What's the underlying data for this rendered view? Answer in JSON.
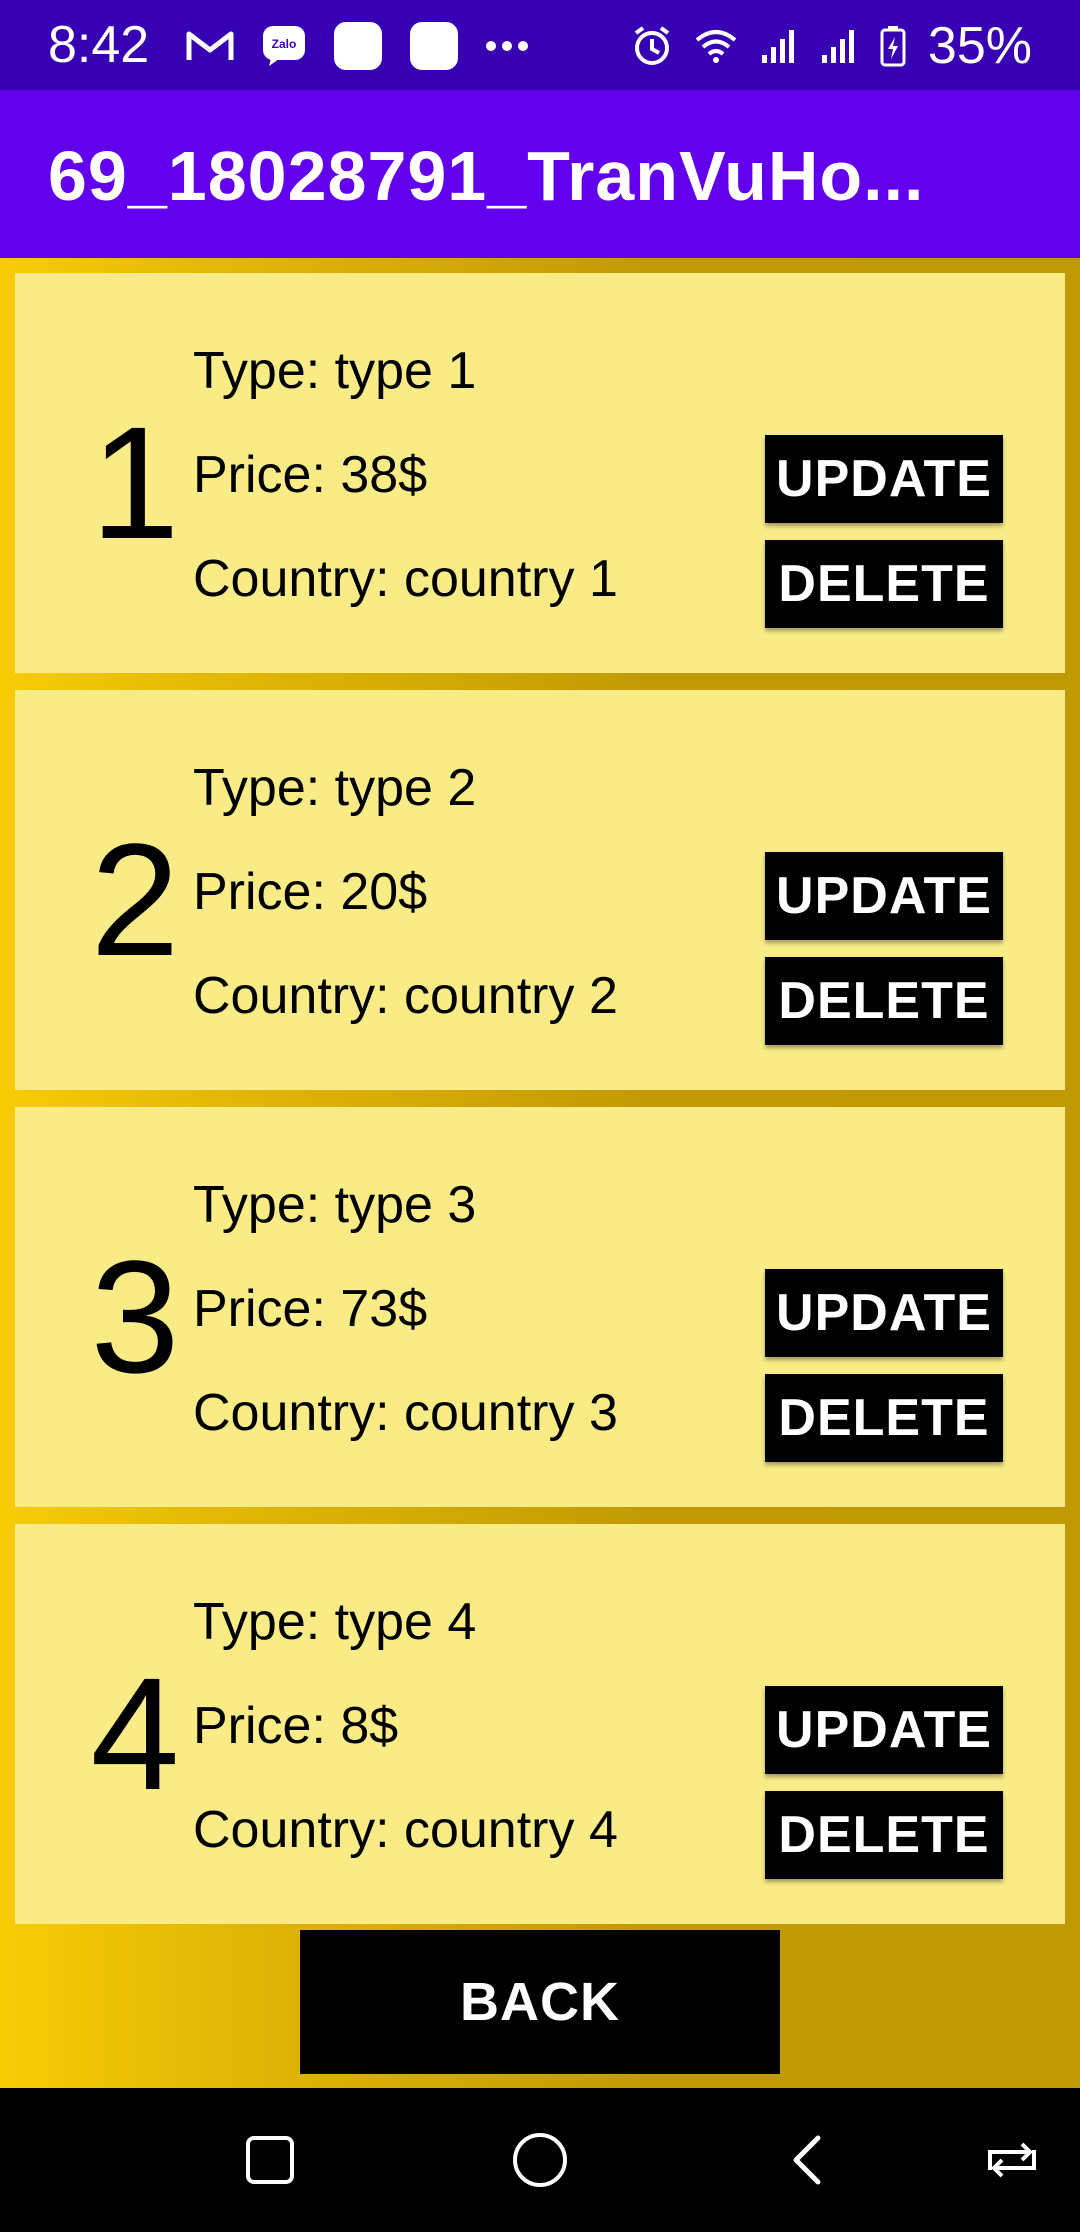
{
  "status_bar": {
    "time": "8:42",
    "battery": "35%",
    "left_icons": [
      "gmail-icon",
      "zalo-icon",
      "app-icon",
      "app-icon",
      "more-notifications-icon"
    ],
    "right_icons": [
      "alarm-icon",
      "wifi-icon",
      "signal-icon",
      "signal-icon",
      "battery-icon"
    ],
    "zalo_label": "Zalo"
  },
  "app_bar": {
    "title": "69_18028791_TranVuHo..."
  },
  "items": [
    {
      "number": "1",
      "type": "Type: type 1",
      "price": "Price: 38$",
      "country": "Country: country 1",
      "update_label": "UPDATE",
      "delete_label": "DELETE"
    },
    {
      "number": "2",
      "type": "Type: type 2",
      "price": "Price: 20$",
      "country": "Country: country 2",
      "update_label": "UPDATE",
      "delete_label": "DELETE"
    },
    {
      "number": "3",
      "type": "Type: type 3",
      "price": "Price: 73$",
      "country": "Country: country 3",
      "update_label": "UPDATE",
      "delete_label": "DELETE"
    },
    {
      "number": "4",
      "type": "Type: type 4",
      "price": "Price: 8$",
      "country": "Country: country 4",
      "update_label": "UPDATE",
      "delete_label": "DELETE"
    }
  ],
  "back_label": "BACK",
  "nav_bar": {
    "buttons": [
      "recents-icon",
      "home-icon",
      "back-icon",
      "rotate-icon"
    ]
  },
  "colors": {
    "status_bar": "#3700b3",
    "app_bar": "#6200ee",
    "card": "#f9ec86",
    "button": "#000000",
    "background_gradient_start": "#f7cc04",
    "background_gradient_end": "#bf9a05"
  }
}
